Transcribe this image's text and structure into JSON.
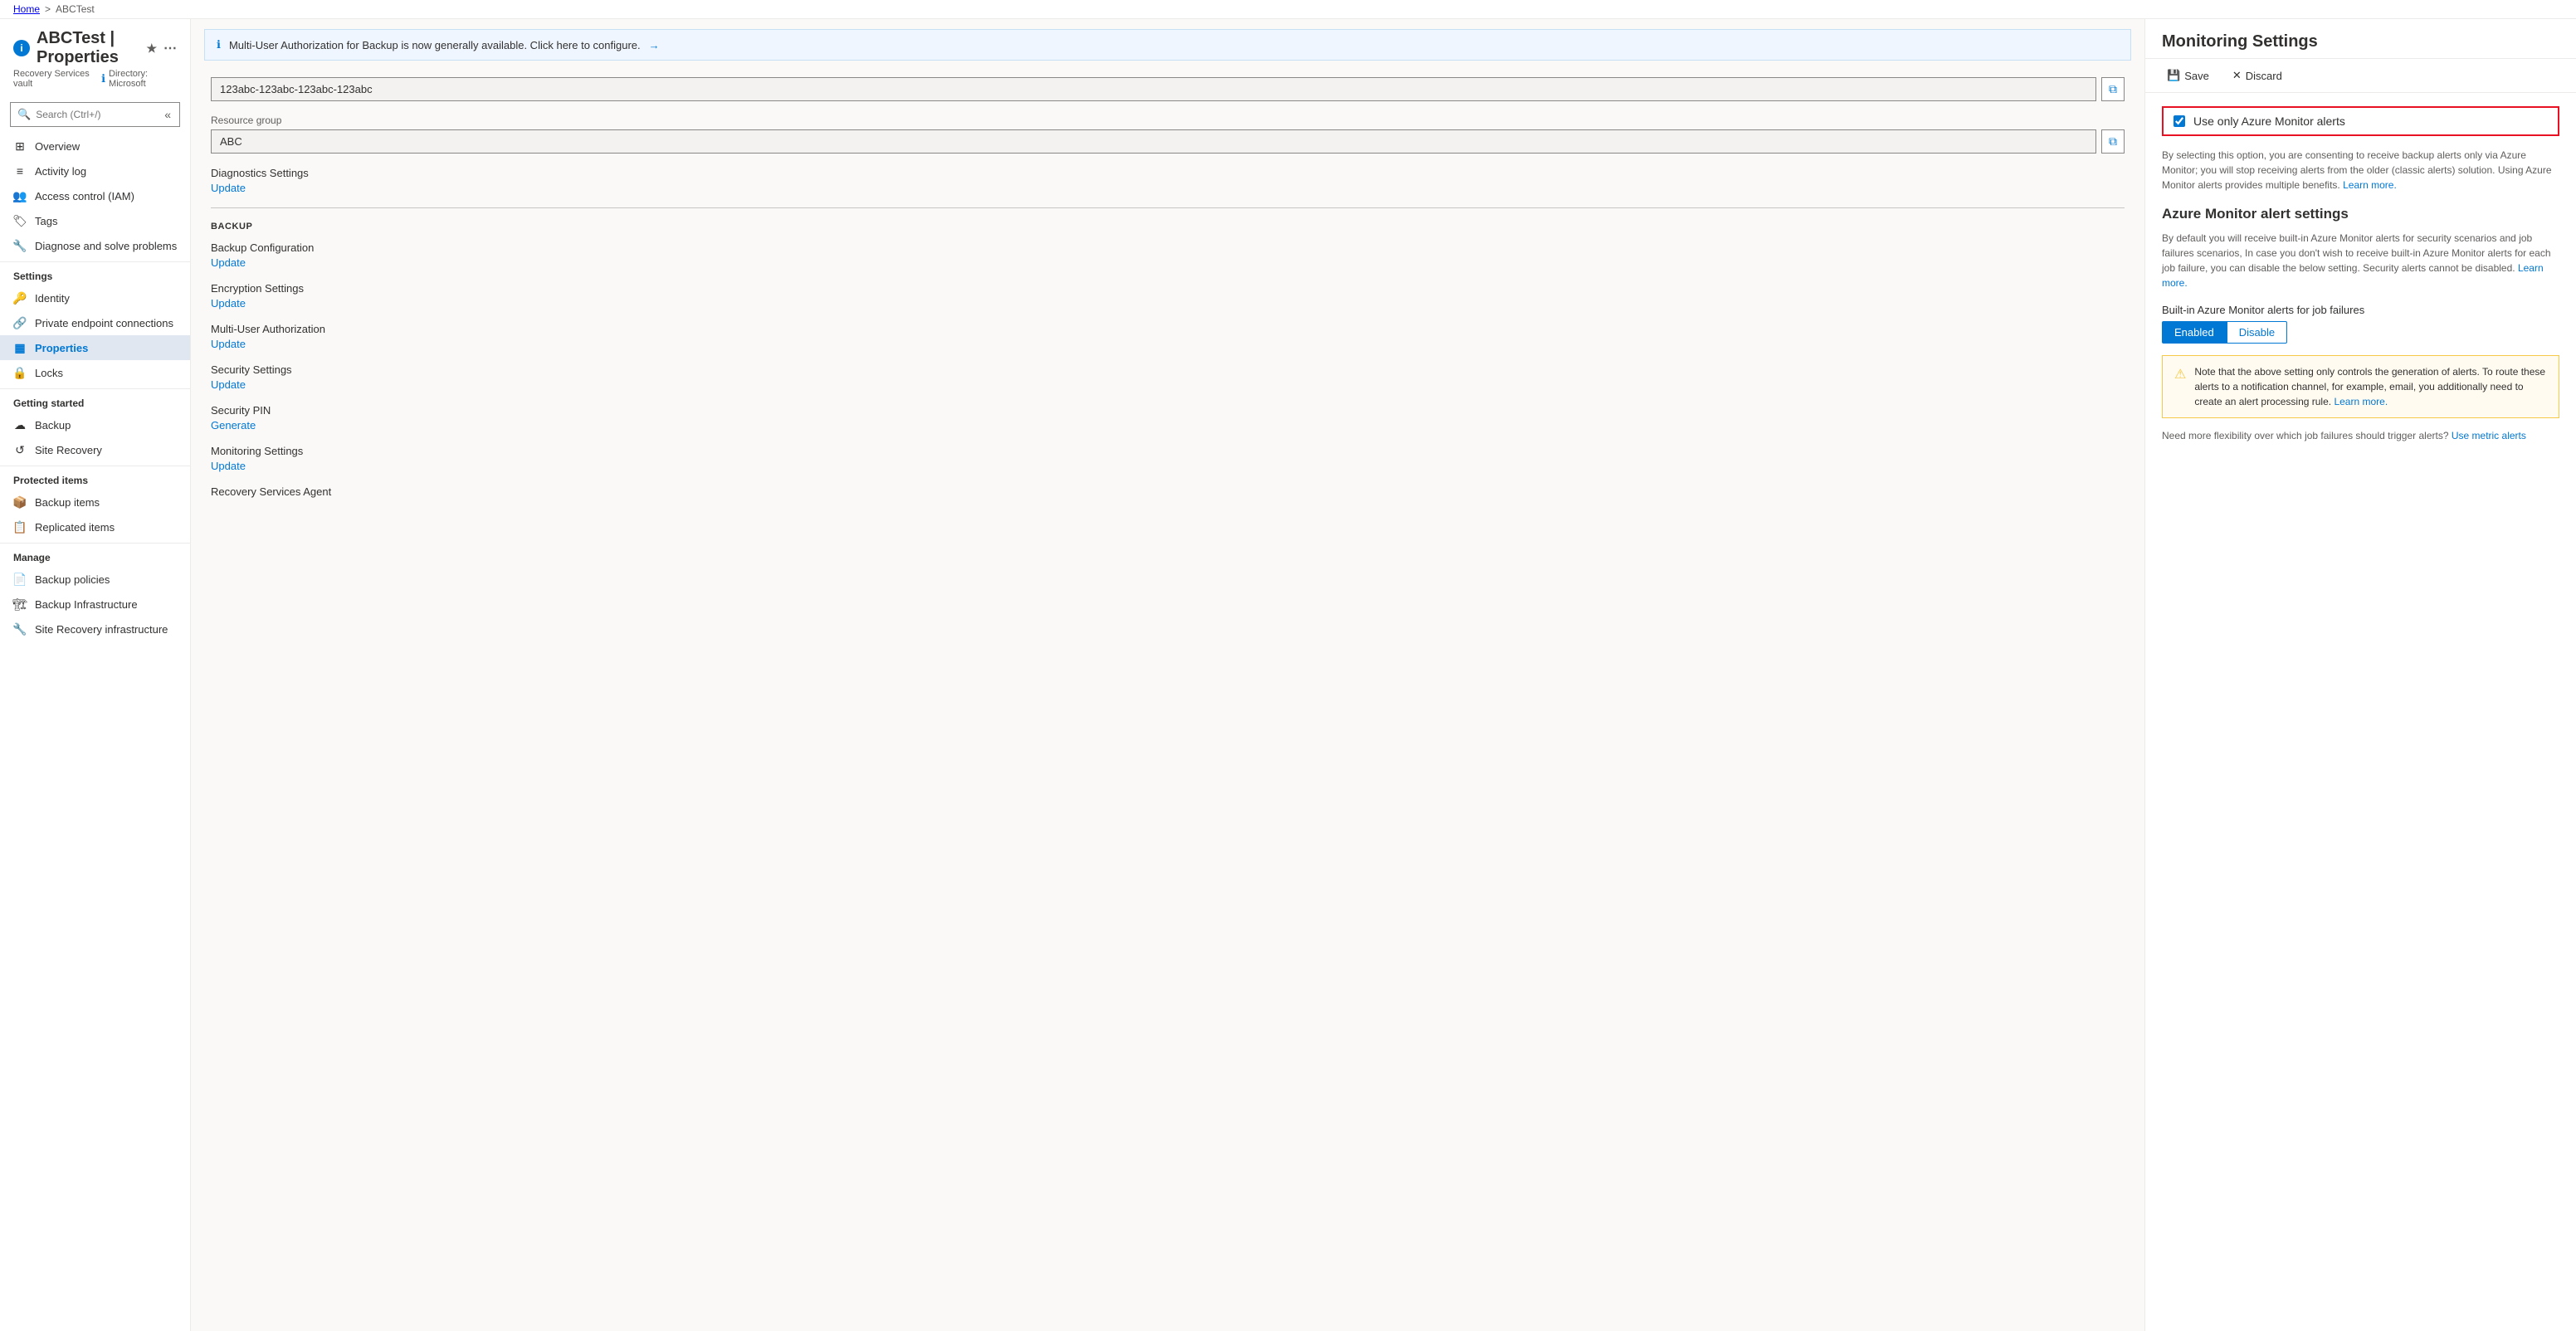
{
  "breadcrumb": {
    "home": "Home",
    "separator": ">",
    "current": "ABCTest"
  },
  "sidebar": {
    "app_icon": "i",
    "title": "ABCTest | Properties",
    "subtitle": "Recovery Services vault",
    "directory_label": "Directory: Microsoft",
    "search_placeholder": "Search (Ctrl+/)",
    "collapse_icon": "«",
    "nav_items": [
      {
        "id": "overview",
        "label": "Overview",
        "icon": "⊞",
        "section": null
      },
      {
        "id": "activity-log",
        "label": "Activity log",
        "icon": "≡",
        "section": null
      },
      {
        "id": "access-control",
        "label": "Access control (IAM)",
        "icon": "👥",
        "section": null
      },
      {
        "id": "tags",
        "label": "Tags",
        "icon": "🏷",
        "section": null
      },
      {
        "id": "diagnose",
        "label": "Diagnose and solve problems",
        "icon": "🔧",
        "section": null
      }
    ],
    "settings_section": "Settings",
    "settings_items": [
      {
        "id": "identity",
        "label": "Identity",
        "icon": "🔑"
      },
      {
        "id": "private-endpoint",
        "label": "Private endpoint connections",
        "icon": "🔗"
      },
      {
        "id": "properties",
        "label": "Properties",
        "icon": "▦",
        "active": true
      },
      {
        "id": "locks",
        "label": "Locks",
        "icon": "🔒"
      }
    ],
    "getting_started_section": "Getting started",
    "getting_started_items": [
      {
        "id": "backup",
        "label": "Backup",
        "icon": "☁"
      },
      {
        "id": "site-recovery",
        "label": "Site Recovery",
        "icon": "↺"
      }
    ],
    "protected_items_section": "Protected items",
    "protected_items": [
      {
        "id": "backup-items",
        "label": "Backup items",
        "icon": "📦"
      },
      {
        "id": "replicated-items",
        "label": "Replicated items",
        "icon": "📋"
      }
    ],
    "manage_section": "Manage",
    "manage_items": [
      {
        "id": "backup-policies",
        "label": "Backup policies",
        "icon": "📄"
      },
      {
        "id": "backup-infrastructure",
        "label": "Backup Infrastructure",
        "icon": "🏗"
      },
      {
        "id": "site-recovery-infrastructure",
        "label": "Site Recovery infrastructure",
        "icon": "🔧"
      }
    ]
  },
  "notification": {
    "text": "Multi-User Authorization for Backup is now generally available. Click here to configure.",
    "icon": "ℹ",
    "arrow": "→"
  },
  "properties": {
    "resource_id_value": "123abc-123abc-123abc-123abc",
    "resource_group_label": "Resource group",
    "resource_group_value": "ABC",
    "diagnostics_section": "Diagnostics Settings",
    "diagnostics_link": "Update",
    "backup_section": "BACKUP",
    "backup_config_label": "Backup Configuration",
    "backup_config_link": "Update",
    "encryption_label": "Encryption Settings",
    "encryption_link": "Update",
    "multi_user_label": "Multi-User Authorization",
    "multi_user_link": "Update",
    "security_settings_label": "Security Settings",
    "security_settings_link": "Update",
    "security_pin_label": "Security PIN",
    "security_pin_link": "Generate",
    "monitoring_label": "Monitoring Settings",
    "monitoring_link": "Update",
    "recovery_agent_label": "Recovery Services Agent"
  },
  "right_panel": {
    "title": "Monitoring Settings",
    "save_label": "Save",
    "discard_label": "Discard",
    "checkbox_label": "Use only Azure Monitor alerts",
    "checkbox_checked": true,
    "description1": "By selecting this option, you are consenting to receive backup alerts only via Azure Monitor; you will stop receiving alerts from the older (classic alerts) solution. Using Azure Monitor alerts provides multiple benefits.",
    "learn_more_1": "Learn more.",
    "subsection_title": "Azure Monitor alert settings",
    "description2": "By default you will receive built-in Azure Monitor alerts for security scenarios and job failures scenarios, In case you don't wish to receive built-in Azure Monitor alerts for each job failure, you can disable the below setting. Security alerts cannot be disabled.",
    "learn_more_2": "Learn more.",
    "toggle_label": "Built-in Azure Monitor alerts for job failures",
    "toggle_enabled": "Enabled",
    "toggle_disable": "Disable",
    "warning_text": "Note that the above setting only controls the generation of alerts. To route these alerts to a notification channel, for example, email, you additionally need to create an alert processing rule.",
    "learn_more_warning": "Learn more.",
    "flexibility_text": "Need more flexibility over which job failures should trigger alerts?",
    "metric_alerts_link": "Use metric alerts",
    "save_icon": "💾",
    "discard_icon": "✕"
  }
}
